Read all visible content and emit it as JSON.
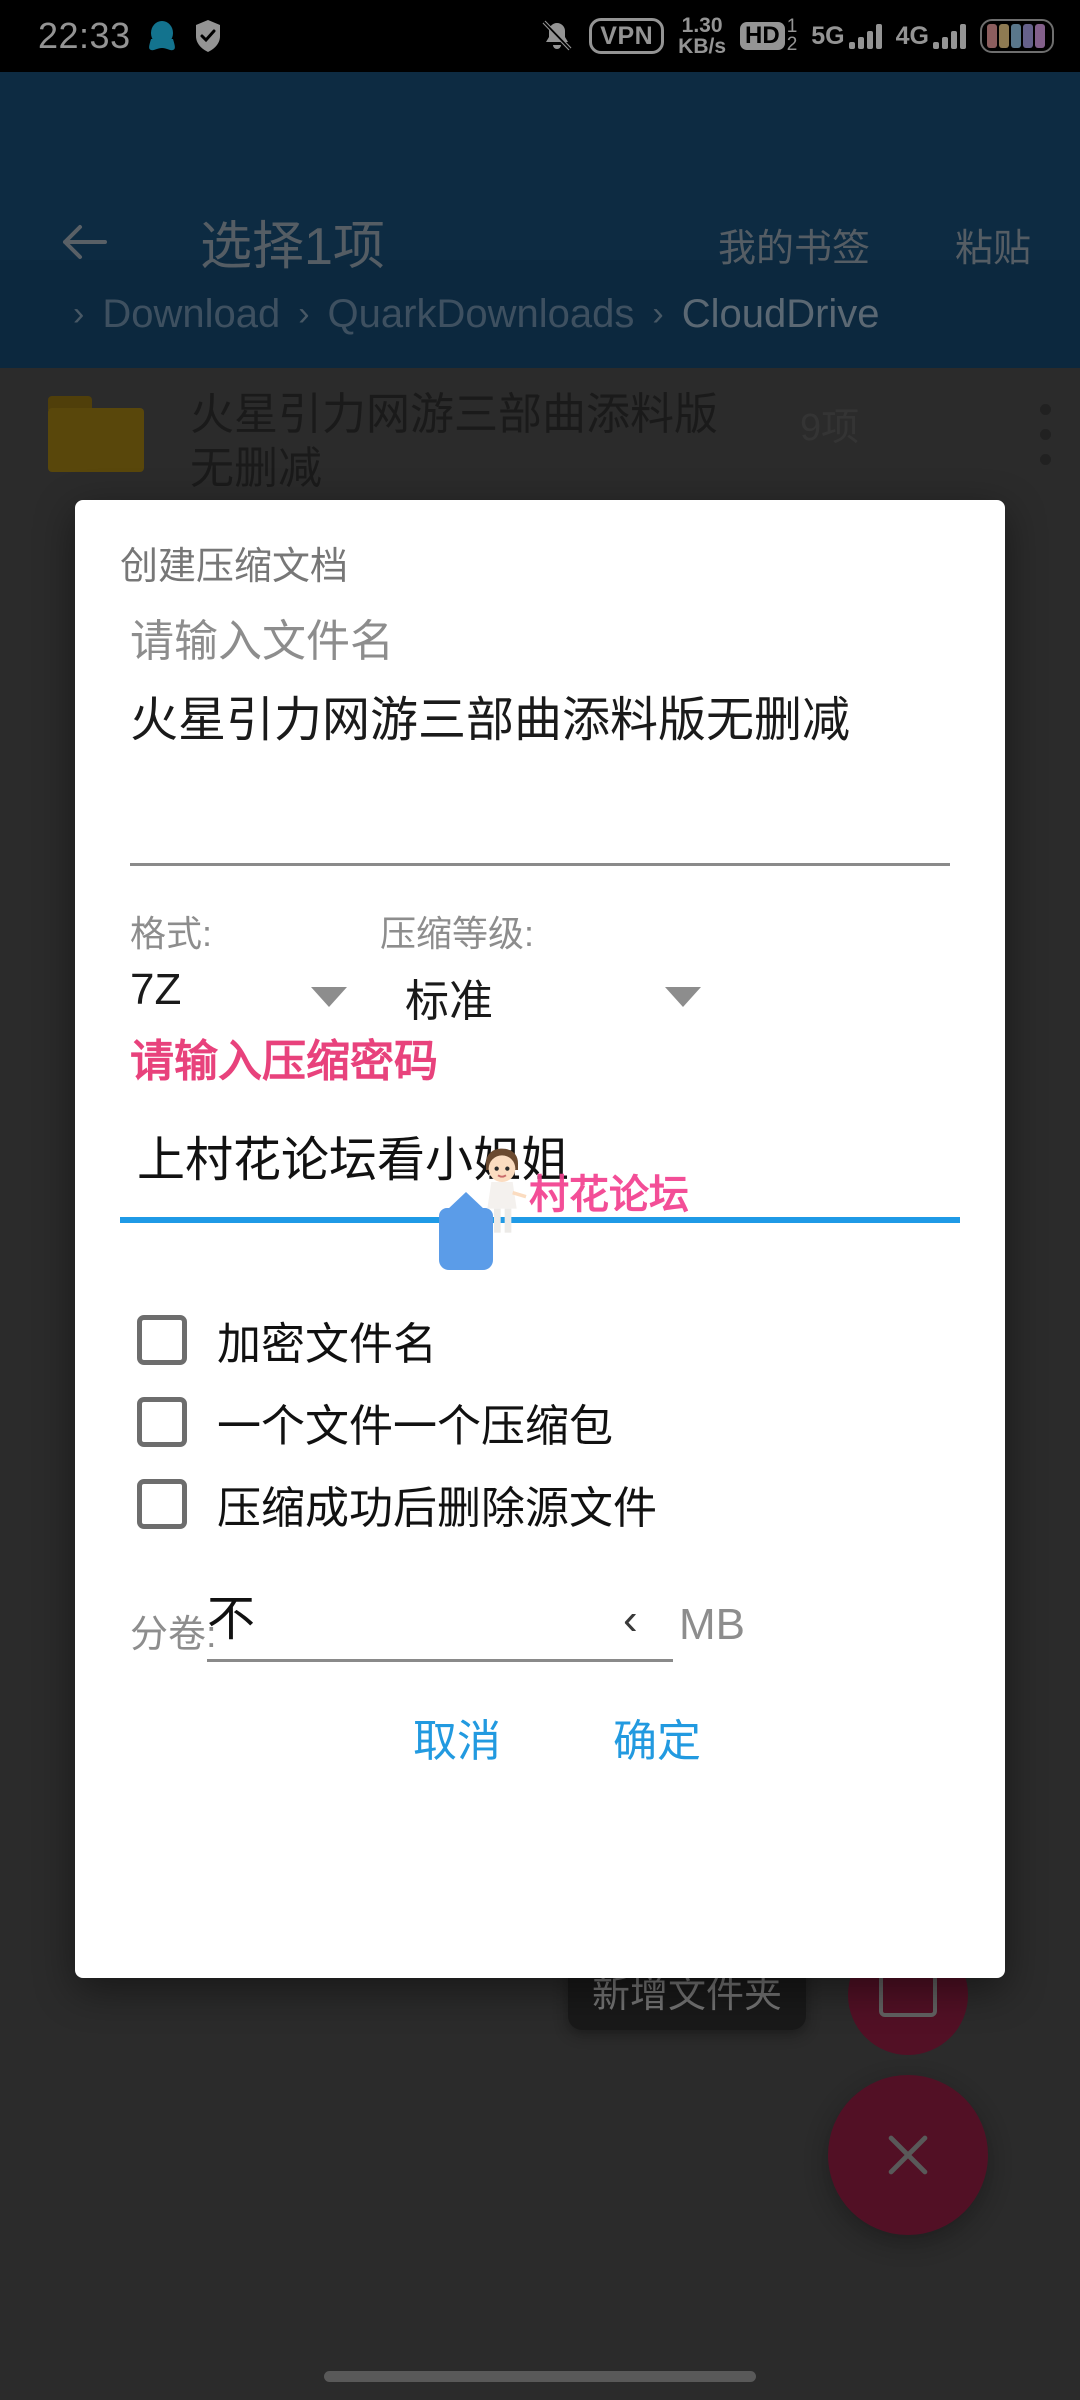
{
  "statusbar": {
    "clock": "22:33",
    "qq_icon": "penguin-icon",
    "shield_icon": "shield-check-icon",
    "mute_icon": "bell-muted-icon",
    "vpn_label": "VPN",
    "net_rate_value": "1.30",
    "net_rate_unit": "KB/s",
    "hd_label": "HD",
    "hd_sup": "1",
    "hd_sub": "2",
    "sim1_label": "5G",
    "sim2_label": "4G",
    "battery_icon": "battery-icon"
  },
  "toolbar": {
    "back_icon": "back-arrow-icon",
    "title": "选择1项",
    "bookmarks_label": "我的书签",
    "paste_label": "粘贴"
  },
  "breadcrumb": {
    "separator": "›",
    "items": [
      "Download",
      "QuarkDownloads",
      "CloudDrive"
    ]
  },
  "filelist": {
    "rows": [
      {
        "icon": "folder-icon",
        "name": "火星引力网游三部曲添料版无删减",
        "count": "9项",
        "menu_icon": "more-vertical-icon"
      }
    ]
  },
  "fabs": {
    "toast_label": "新增文件夹",
    "newfolder_icon": "new-folder-icon",
    "close_icon": "close-icon"
  },
  "dialog": {
    "title": "创建压缩文档",
    "filename": {
      "label": "请输入文件名",
      "value": "火星引力网游三部曲添料版无删减"
    },
    "format": {
      "label": "格式:",
      "value": "7Z",
      "caret_icon": "chevron-down-icon"
    },
    "level": {
      "label": "压缩等级:",
      "value": "标准",
      "caret_icon": "chevron-down-icon"
    },
    "password": {
      "label": "请输入压缩密码",
      "value": "上村花论坛看小姐姐",
      "label_color": "#e8427c",
      "underline_color": "#1f9ae6",
      "handle_icon": "text-selection-handle-icon"
    },
    "watermark": {
      "text": "村花论坛",
      "figure_icon": "cartoon-girl-icon",
      "color": "#f2408f"
    },
    "checkboxes": [
      {
        "label": "加密文件名",
        "checked": false
      },
      {
        "label": "一个文件一个压缩包",
        "checked": false
      },
      {
        "label": "压缩成功后删除源文件",
        "checked": false
      }
    ],
    "split": {
      "label": "分卷:",
      "value": "不",
      "chevron_icon": "chevron-left-icon",
      "unit": "MB"
    },
    "actions": {
      "cancel_label": "取消",
      "confirm_label": "确定",
      "accent_color": "#229ae0"
    }
  }
}
